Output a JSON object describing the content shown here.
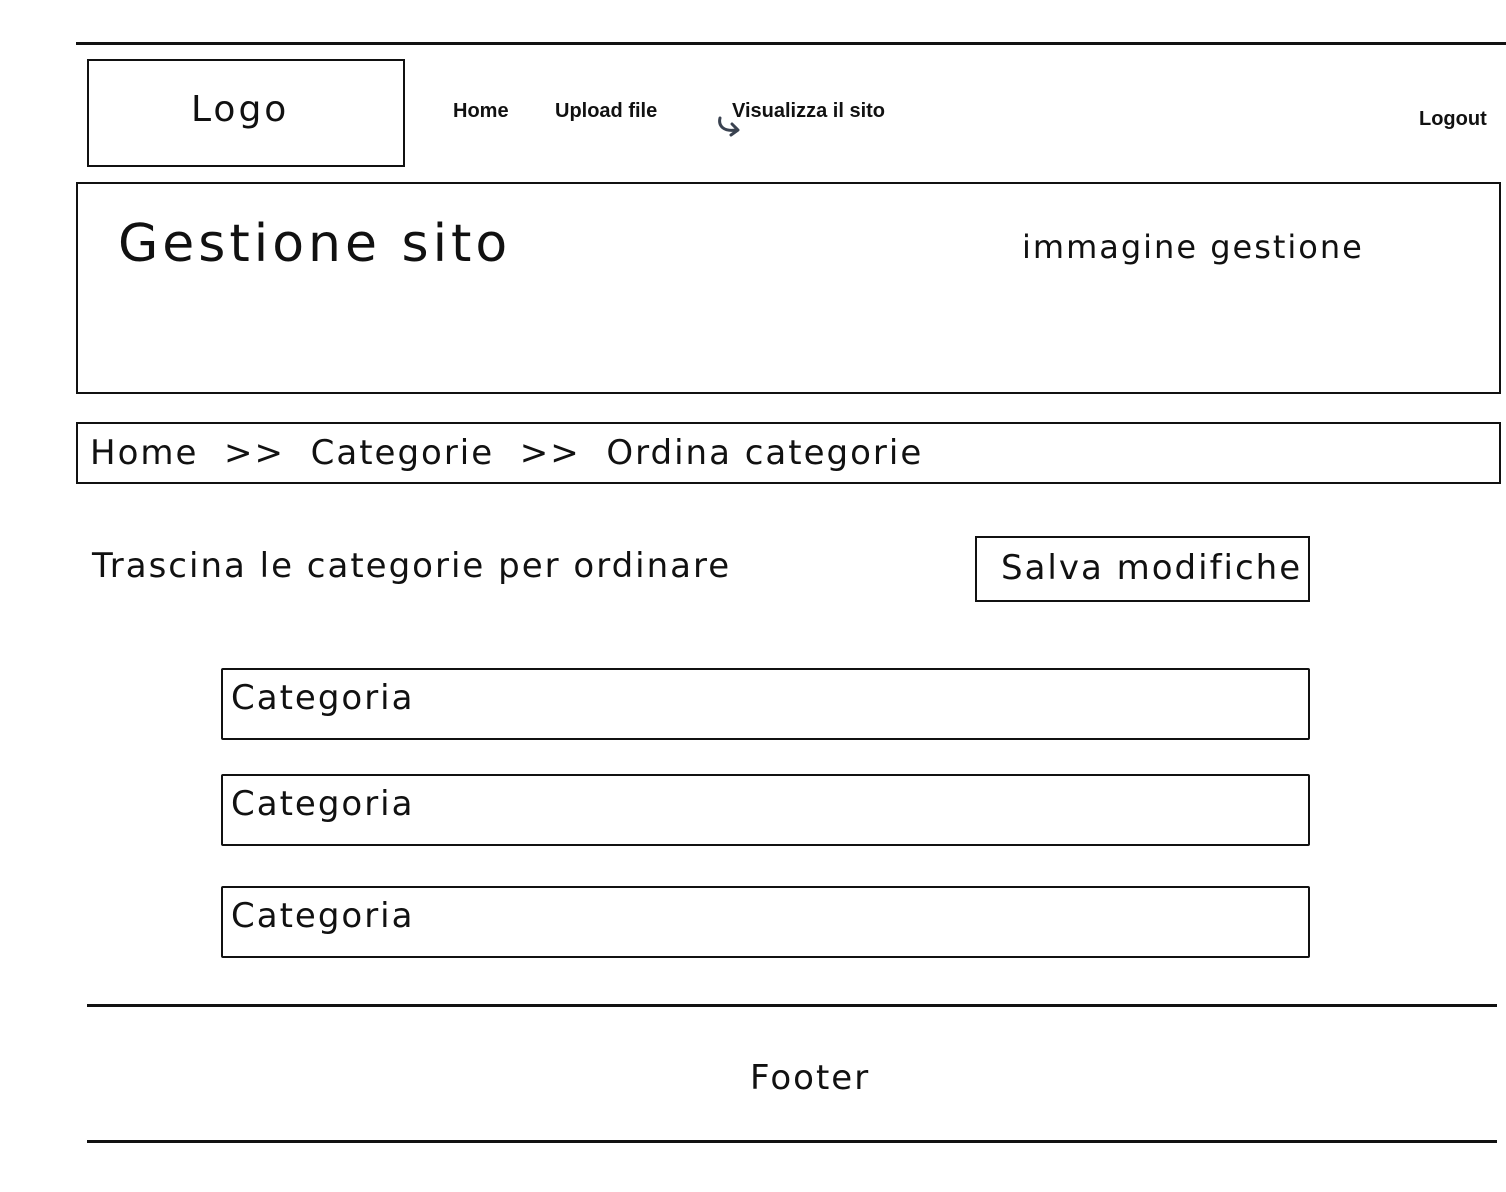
{
  "header": {
    "logo_label": "Logo",
    "nav": {
      "home": "Home",
      "upload": "Upload file",
      "view_site": "Visualizza il sito",
      "logout": "Logout"
    }
  },
  "banner": {
    "title": "Gestione sito",
    "image_placeholder": "immagine gestione"
  },
  "breadcrumb": {
    "text": "Home  >>  Categorie  >>  Ordina categorie"
  },
  "main": {
    "instruction": "Trascina le categorie per ordinare",
    "save_label": "Salva modifiche",
    "categories": [
      "Categoria",
      "Categoria",
      "Categoria"
    ]
  },
  "footer": {
    "label": "Footer"
  },
  "icons": {
    "view_site_icon": "curved-arrow-icon"
  }
}
